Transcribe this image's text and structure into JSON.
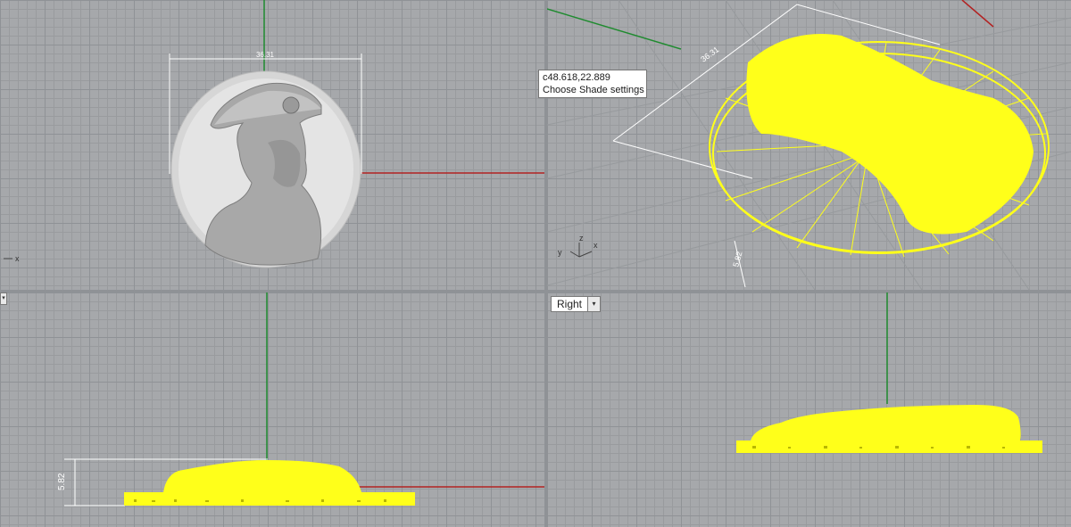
{
  "tooltip": {
    "coordinates": "c48.618,22.889",
    "text": "Choose Shade settings"
  },
  "viewports": {
    "top": {
      "dimension": "36.31",
      "axis_x": "x"
    },
    "perspective": {
      "dimension_width": "36.31",
      "dimension_height": "5.82",
      "axis_x": "x",
      "axis_y": "y",
      "axis_z": "z"
    },
    "front": {
      "dimension_height": "5.82"
    },
    "right": {
      "label": "Right",
      "dropdown": "▾"
    }
  },
  "colors": {
    "grid_bg": "#a6a8ab",
    "model_yellow": "#ffff1a",
    "axis_red": "#b22222",
    "axis_green": "#1f8b2f",
    "medallion": "#d9d9d9"
  }
}
